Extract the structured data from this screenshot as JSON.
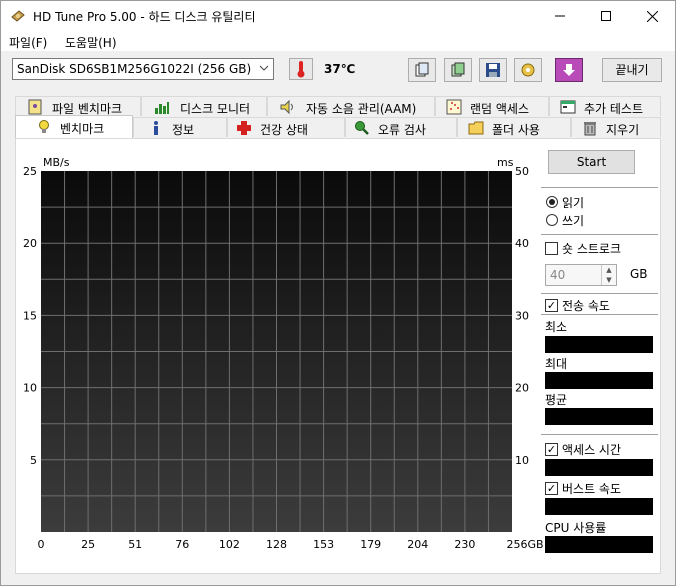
{
  "window": {
    "title": "HD Tune Pro 5.00 - 하드 디스크 유틸리티",
    "minimize": "—",
    "maximize": "☐",
    "close": "✕"
  },
  "menu": {
    "items": [
      "파일(F)",
      "도움말(H)"
    ]
  },
  "toolbar": {
    "drive": "SanDisk SD6SB1M256G1022I (256 GB)",
    "temperature": "37℃",
    "exit_label": "끝내기",
    "buttons": [
      "copy-info-icon",
      "copy-screenshot-icon",
      "save-icon",
      "options-icon",
      "download-icon"
    ]
  },
  "tabs": {
    "row1": [
      "파일 벤치마크",
      "디스크 모니터",
      "자동 소음 관리(AAM)",
      "랜덤 액세스",
      "추가 테스트"
    ],
    "row2": [
      "벤치마크",
      "정보",
      "건강 상태",
      "오류 검사",
      "폴더 사용",
      "지우기"
    ],
    "active": "벤치마크"
  },
  "chart_data": {
    "type": "line",
    "y_left_unit": "MB/s",
    "y_right_unit": "ms",
    "y_left_ticks": [
      "25",
      "20",
      "15",
      "10",
      "5"
    ],
    "y_right_ticks": [
      "50",
      "40",
      "30",
      "20",
      "10"
    ],
    "ylim_left": [
      0,
      25
    ],
    "ylim_right": [
      0,
      50
    ],
    "x_ticks": [
      "0",
      "25",
      "51",
      "76",
      "102",
      "128",
      "153",
      "179",
      "204",
      "230",
      "256GB"
    ],
    "grid": true,
    "series": []
  },
  "panel": {
    "start_label": "Start",
    "read_label": "읽기",
    "write_label": "쓰기",
    "read_selected": true,
    "short_stroke_label": "숏 스트로크",
    "short_stroke_checked": false,
    "stroke_value": "40",
    "stroke_unit": "GB",
    "transfer_rate_label": "전송 속도",
    "transfer_rate_checked": true,
    "min_label": "최소",
    "max_label": "최대",
    "avg_label": "평균",
    "access_time_label": "액세스 시간",
    "access_time_checked": true,
    "burst_rate_label": "버스트 속도",
    "burst_rate_checked": true,
    "cpu_label": "CPU 사용률",
    "check_mark": "✓"
  }
}
